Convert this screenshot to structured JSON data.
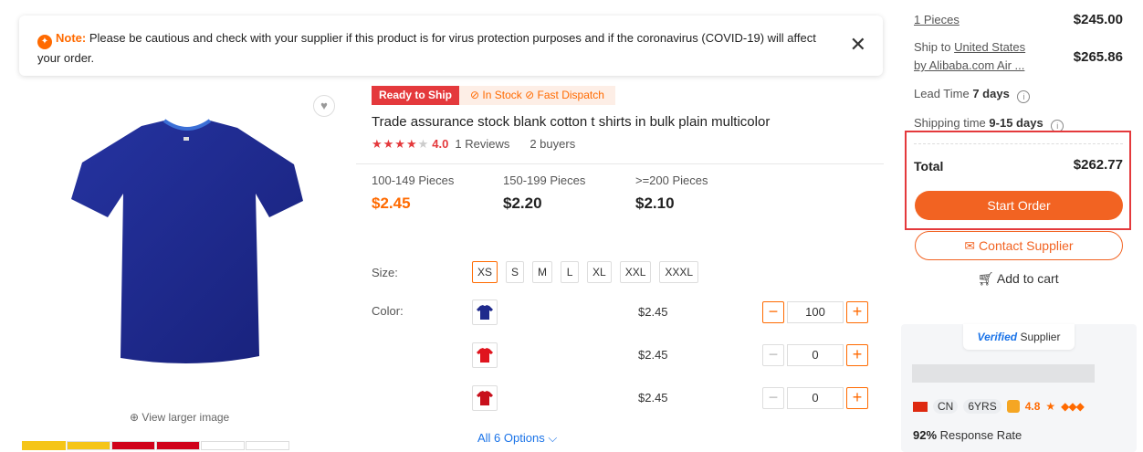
{
  "note": {
    "label": "Note:",
    "text": " Please be cautious and check with your supplier if this product is for virus protection purposes and if the coronavirus (COVID-19) will affect your order."
  },
  "gallery": {
    "view_larger": "View larger image",
    "main_color": "#1f2a8c"
  },
  "product": {
    "tag_ready": "Ready to Ship",
    "tag_stock": "In Stock",
    "tag_dispatch": "Fast Dispatch",
    "title": "Trade assurance stock blank cotton t shirts in bulk plain multicolor",
    "rating": "4.0",
    "rating_value": 4,
    "reviews": "1 Reviews",
    "buyers": "2 buyers"
  },
  "tiers": [
    {
      "qty": "100-149 Pieces",
      "price": "$2.45"
    },
    {
      "qty": "150-199 Pieces",
      "price": "$2.20"
    },
    {
      "qty": ">=200 Pieces",
      "price": "$2.10"
    }
  ],
  "size": {
    "label": "Size:",
    "options": [
      "XS",
      "S",
      "M",
      "L",
      "XL",
      "XXL",
      "XXXL"
    ],
    "selected": "XS"
  },
  "color": {
    "label": "Color:",
    "rows": [
      {
        "swatch": "#1f2a8c",
        "price": "$2.45",
        "qty": "100"
      },
      {
        "swatch": "#e0141e",
        "price": "$2.45",
        "qty": "0"
      },
      {
        "swatch": "#c8101c",
        "price": "$2.45",
        "qty": "0"
      }
    ],
    "all_options": "All 6 Options"
  },
  "order": {
    "pieces": "1 Pieces",
    "pieces_price": "$245.00",
    "ship_to_label": "Ship to",
    "ship_to": "United States",
    "ship_via": "by Alibaba.com Air ...",
    "ship_price": "$265.86",
    "lead_time_label": "Lead Time",
    "lead_time": "7 days",
    "shipping_time_label": "Shipping time",
    "shipping_time": "9-15 days",
    "total_label": "Total",
    "total": "$262.77",
    "start_order": "Start Order",
    "contact_supplier": "Contact Supplier",
    "add_to_cart": "Add to cart",
    "accent": "#f26322"
  },
  "supplier": {
    "verified": "Verified",
    "verified_suffix": "Supplier",
    "country": "CN",
    "years": "6YRS",
    "score": "4.8",
    "response_rate": "92%",
    "response_label": "Response Rate"
  }
}
